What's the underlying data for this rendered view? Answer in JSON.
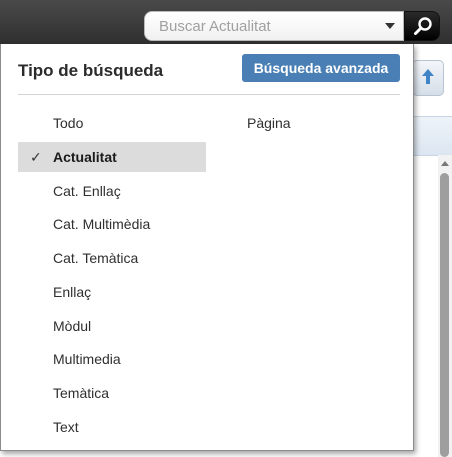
{
  "search": {
    "placeholder": "Buscar Actualitat"
  },
  "panel": {
    "title": "Tipo de búsqueda",
    "advanced_button": "Búsqueda avanzada",
    "selected_marker": "✓",
    "options_col1": [
      {
        "label": "Todo",
        "selected": false
      },
      {
        "label": "Actualitat",
        "selected": true
      },
      {
        "label": "Cat. Enllaç",
        "selected": false
      },
      {
        "label": "Cat. Multimèdia",
        "selected": false
      },
      {
        "label": "Cat. Temàtica",
        "selected": false
      },
      {
        "label": "Enllaç",
        "selected": false
      },
      {
        "label": "Mòdul",
        "selected": false
      },
      {
        "label": "Multimedia",
        "selected": false
      },
      {
        "label": "Temàtica",
        "selected": false
      },
      {
        "label": "Text",
        "selected": false
      }
    ],
    "options_col2": [
      {
        "label": "Pàgina",
        "selected": false
      }
    ]
  },
  "colors": {
    "accent": "#4a7fb5",
    "selected_bg": "#dcdcdc",
    "topbar": "#3a3a3a"
  },
  "icons": {
    "search_button": "magnifier-icon",
    "dropdown": "caret-down-icon",
    "selected": "checkmark-icon",
    "behind_toolbar": "upload-arrow-icon"
  }
}
